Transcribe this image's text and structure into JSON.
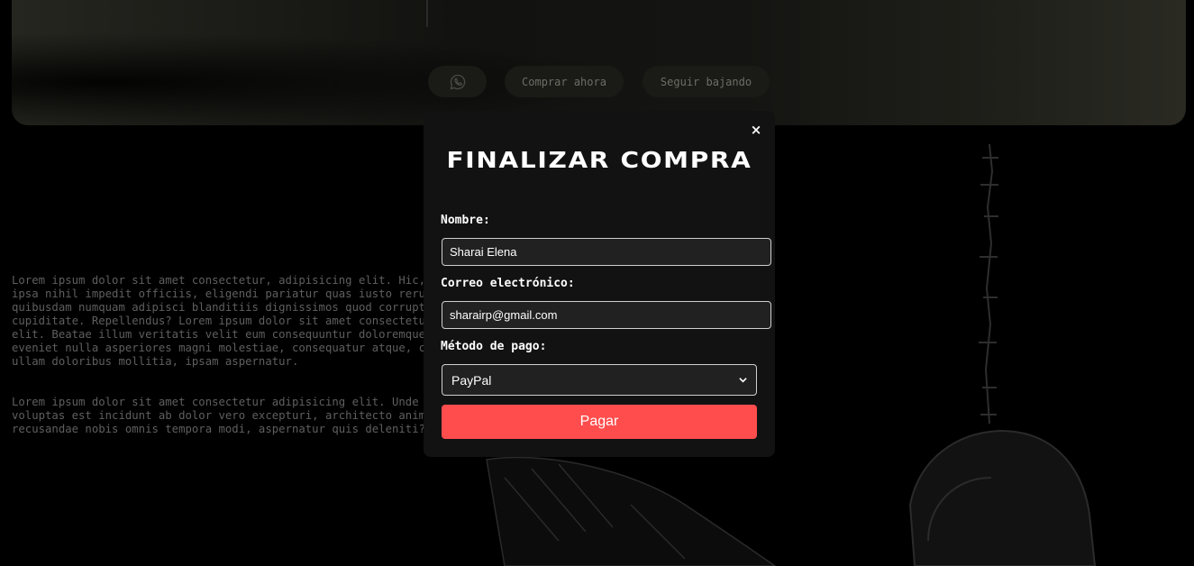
{
  "hero": {
    "buy_label": "Comprar ahora",
    "scroll_label": "Seguir bajando",
    "whatsapp_icon": "whatsapp-icon"
  },
  "content": {
    "paragraph1": "Lorem ipsum dolor sit amet consectetur, adipisicing elit. Hic, ipsa\nipsa nihil impedit officiis, eligendi pariatur quas iusto rerum\nquibusdam numquam adipisci blanditiis dignissimos quod corrupti\ncupiditate. Repellendus? Lorem ipsum dolor sit amet consectetur\nelit. Beatae illum veritatis velit eum consequuntur doloremque f\neveniet nulla asperiores magni molestiae, consequatur atque, cum\nullam doloribus mollitia, ipsam aspernatur.",
    "paragraph2": "Lorem ipsum dolor sit amet consectetur adipisicing elit. Unde pl\nvoluptas est incidunt ab dolor vero excepturi, architecto animi\nrecusandae nobis omnis tempora modi, aspernatur quis deleniti?"
  },
  "modal": {
    "close_label": "×",
    "title": "FINALIZAR COMPRA",
    "name_label": "Nombre:",
    "name_value": "Sharai Elena",
    "email_label": "Correo electrónico:",
    "email_value": "sharairp@gmail.com",
    "payment_label": "Método de pago:",
    "payment_value": "PayPal",
    "pay_button": "Pagar",
    "pay_color": "#ff4d4d"
  }
}
